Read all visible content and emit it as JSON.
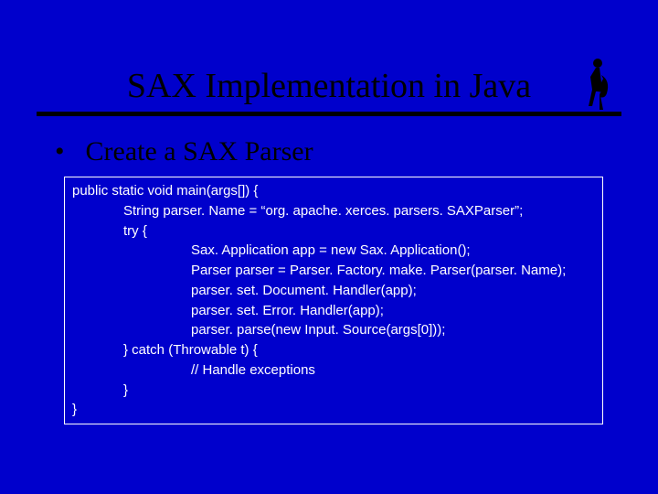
{
  "title": "SAX Implementation in Java",
  "bullet": {
    "marker": "•",
    "text": "Create a SAX Parser"
  },
  "code": {
    "l0": "public static void main(args[]) {",
    "l1": "String parser. Name = “org. apache. xerces. parsers. SAXParser”;",
    "l2": "try {",
    "l3": "Sax. Application app = new Sax. Application();",
    "l4": "Parser parser = Parser. Factory. make. Parser(parser. Name);",
    "l5": "parser. set. Document. Handler(app);",
    "l6": "parser. set. Error. Handler(app);",
    "l7": "parser. parse(new Input. Source(args[0]));",
    "l8": "} catch (Throwable t) {",
    "l9": "// Handle exceptions",
    "l10": "}",
    "l11": "}"
  }
}
